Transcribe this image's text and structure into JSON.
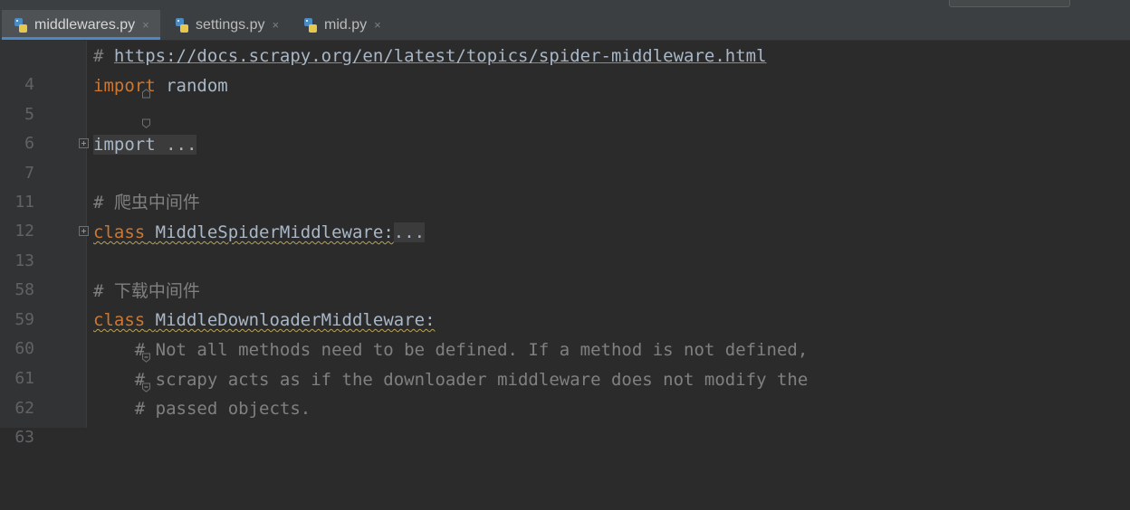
{
  "tabs": [
    {
      "label": "middlewares.py",
      "active": true
    },
    {
      "label": "settings.py",
      "active": false
    },
    {
      "label": "mid.py",
      "active": false
    }
  ],
  "tab_close_glyph": "×",
  "lines": [
    {
      "num": "4",
      "comment_hash": "# ",
      "url": "https://docs.scrapy.org/en/latest/topics/spider-middleware.html"
    },
    {
      "num": "5",
      "kw": "import",
      "rest": " random"
    },
    {
      "num": "6"
    },
    {
      "num": "7",
      "collapsed": "import ..."
    },
    {
      "num": "11"
    },
    {
      "num": "12",
      "comment": "# 爬虫中间件"
    },
    {
      "num": "13",
      "kw": "class",
      "name": "MiddleSpiderMiddleware:",
      "collapsed": "..."
    },
    {
      "num": "58"
    },
    {
      "num": "59",
      "comment": "# 下载中间件"
    },
    {
      "num": "60",
      "kw": "class",
      "name": "MiddleDownloaderMiddleware:"
    },
    {
      "num": "61",
      "comment": "    # Not all methods need to be defined. If a method is not defined,"
    },
    {
      "num": "62",
      "comment": "    # scrapy acts as if the downloader middleware does not modify the"
    },
    {
      "num": "63",
      "comment": "    # passed objects."
    }
  ],
  "colors": {
    "background": "#2b2b2b",
    "keyword": "#cc7832",
    "comment": "#808080",
    "text": "#a9b7c6",
    "line_number": "#606366",
    "active_tab_underline": "#4a88c7"
  }
}
